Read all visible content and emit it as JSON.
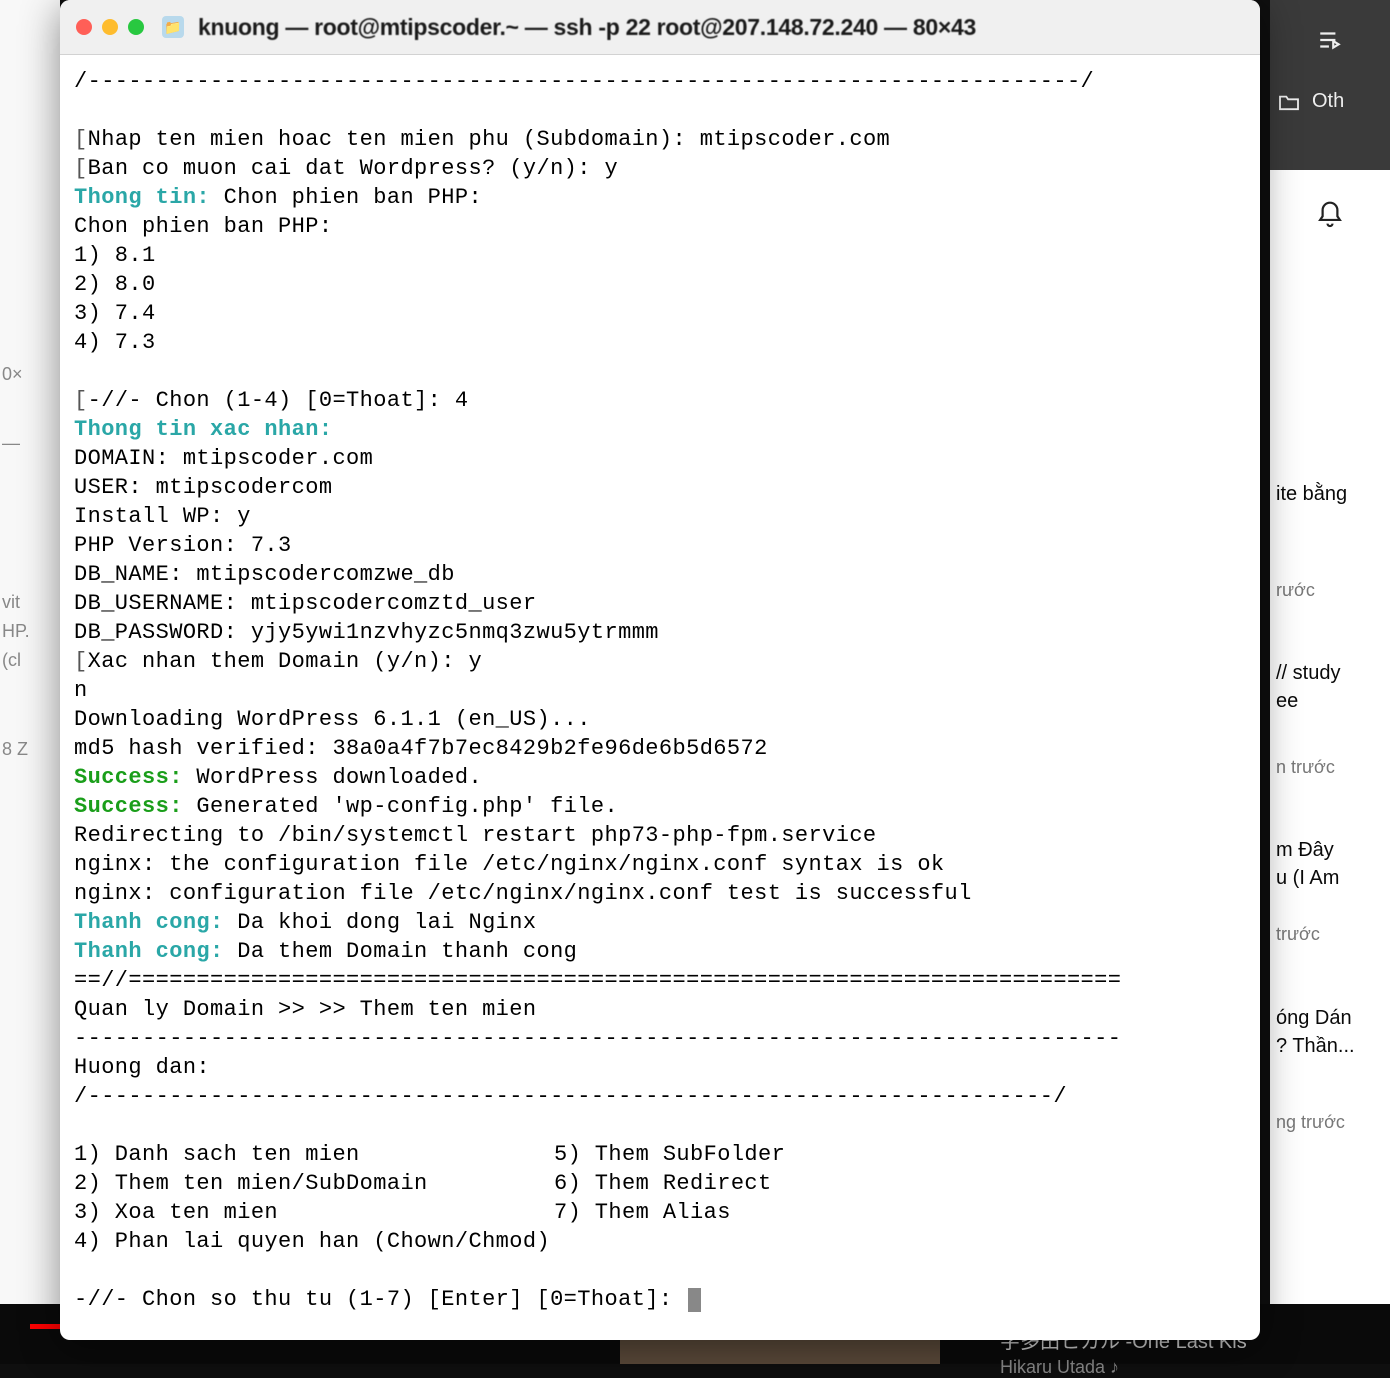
{
  "bg_left": {
    "frag1": "0×",
    "frag2": "vit",
    "frag3": "HP.",
    "frag4": "(cl",
    "frag5": "8 Z"
  },
  "bg_right_header": {
    "other_label": "Oth"
  },
  "yt_items": [
    {
      "title": "ite bằng",
      "meta": "rước"
    },
    {
      "title": "// study",
      "title2": "ee",
      "meta": "n trước"
    },
    {
      "title": "m Đây",
      "title2": "u (I Am",
      "meta": "trước"
    },
    {
      "title": "óng Dán",
      "title2": "? Thần...",
      "meta": "ng trước"
    },
    {
      "title": "字多田ヒカル -One Last Kis",
      "meta": "Hikaru Utada ♪"
    }
  ],
  "window": {
    "title": "knuong — root@mtipscoder.~ — ssh -p 22 root@207.148.72.240 — 80×43"
  },
  "terminal": {
    "divider_top": "/-------------------------------------------------------------------------/",
    "input_domain_prompt": "Nhap ten mien hoac ten mien phu (Subdomain): ",
    "input_domain_value": "mtipscoder.com",
    "input_wp_prompt": "Ban co muon cai dat Wordpress? (y/n): ",
    "input_wp_value": "y",
    "info_label": "Thong tin:",
    "info_text": " Chon phien ban PHP:",
    "php_header": "Chon phien ban PHP:",
    "php_opts": [
      "1) 8.1",
      "2) 8.0",
      "3) 7.4",
      "4) 7.3"
    ],
    "choose_prompt": "-//- Chon (1-4) [0=Thoat]: ",
    "choose_value": "4",
    "confirm_label": "Thong tin xac nhan:",
    "confirm_lines": [
      "DOMAIN: mtipscoder.com",
      "USER: mtipscodercom",
      "Install WP: y",
      "PHP Version: 7.3",
      "DB_NAME: mtipscodercomzwe_db",
      "DB_USERNAME: mtipscodercomztd_user",
      "DB_PASSWORD: yjy5ywi1nzvhyzc5nmq3zwu5ytrmmm"
    ],
    "confirm_prompt": "Xac nhan them Domain (y/n): ",
    "confirm_value": "y",
    "n_line": "n",
    "download_line": "Downloading WordPress 6.1.1 (en_US)...",
    "md5_line": "md5 hash verified: 38a0a4f7b7ec8429b2fe96de6b5d6572",
    "success_label": "Success:",
    "success1": " WordPress downloaded.",
    "success2": " Generated 'wp-config.php' file.",
    "redirect_line": "Redirecting to /bin/systemctl restart php73-php-fpm.service",
    "nginx1": "nginx: the configuration file /etc/nginx/nginx.conf syntax is ok",
    "nginx2": "nginx: configuration file /etc/nginx/nginx.conf test is successful",
    "thanhcong_label": "Thanh cong:",
    "thanhcong1": " Da khoi dong lai Nginx",
    "thanhcong2": " Da them Domain thanh cong",
    "sep_eq": "==//=========================================================================",
    "breadcrumb": "Quan ly Domain >> >> Them ten mien",
    "sep_dash": "-----------------------------------------------------------------------------",
    "huongdan": "Huong dan:",
    "divider_bottom": "/-----------------------------------------------------------------------/",
    "menu_col1": [
      "1) Danh sach ten mien",
      "2) Them ten mien/SubDomain",
      "3) Xoa ten mien",
      "4) Phan lai quyen han (Chown/Chmod)"
    ],
    "menu_col2": [
      "5) Them SubFolder",
      "6) Them Redirect",
      "7) Them Alias"
    ],
    "final_prompt": "-//- Chon so thu tu (1-7) [Enter] [0=Thoat]: "
  }
}
